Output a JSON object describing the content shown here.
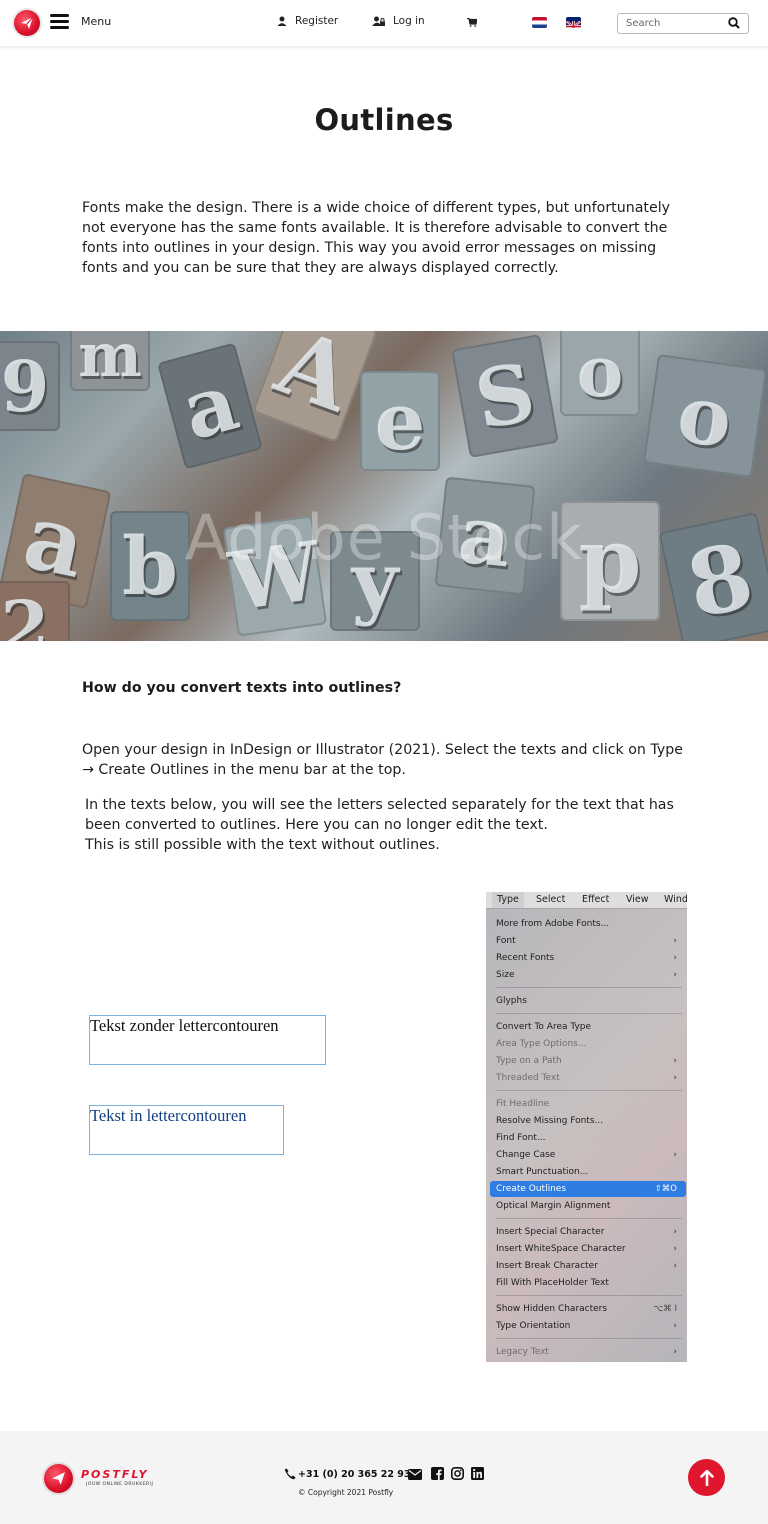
{
  "header": {
    "menu_label": "Menu",
    "register_label": "Register",
    "login_label": "Log in",
    "search_placeholder": "Search",
    "languages": [
      "nl",
      "en"
    ],
    "brand_color": "#e0162f"
  },
  "main": {
    "title": "Outlines",
    "intro": "Fonts make the design. There is a wide choice of different types, but unfortunately not everyone has the same fonts available. It is therefore advisable to convert the fonts into outlines in your design. This way you avoid error messages on missing fonts and you can be sure that they are always displayed correctly.",
    "hero_watermark": "Adobe Stock",
    "subheading": "How do you convert texts into outlines?",
    "para1": "Open your design in InDesign or Illustrator (2021). Select the texts and click on Type → Create Outlines in the menu bar at the top.",
    "para2": "In the texts below, you will see the letters selected separately for the text that has been converted to outlines. Here you can no longer edit the text.\nThis is still possible with the text without outlines.",
    "demo_without": "Tekst zonder lettercontouren",
    "demo_with": "Tekst in lettercontouren"
  },
  "menu_shot": {
    "menubar": [
      "Type",
      "Select",
      "Effect",
      "View",
      "Wind"
    ],
    "items": [
      {
        "label": "More from Adobe Fonts...",
        "arrow": false,
        "dim": false
      },
      {
        "label": "Font",
        "arrow": true,
        "dim": false
      },
      {
        "label": "Recent Fonts",
        "arrow": true,
        "dim": false
      },
      {
        "label": "Size",
        "arrow": true,
        "dim": false
      },
      {
        "label": "Glyphs",
        "arrow": false,
        "dim": false
      },
      {
        "label": "Convert To Area Type",
        "arrow": false,
        "dim": false
      },
      {
        "label": "Area Type Options...",
        "arrow": false,
        "dim": true
      },
      {
        "label": "Type on a Path",
        "arrow": true,
        "dim": true
      },
      {
        "label": "Threaded Text",
        "arrow": true,
        "dim": true
      },
      {
        "label": "Fit Headline",
        "arrow": false,
        "dim": true
      },
      {
        "label": "Resolve Missing Fonts...",
        "arrow": false,
        "dim": false
      },
      {
        "label": "Find Font...",
        "arrow": false,
        "dim": false
      },
      {
        "label": "Change Case",
        "arrow": true,
        "dim": false
      },
      {
        "label": "Smart Punctuation...",
        "arrow": false,
        "dim": false
      },
      {
        "label": "Create Outlines",
        "arrow": false,
        "dim": false,
        "shortcut": "⇧⌘O",
        "highlight": true
      },
      {
        "label": "Optical Margin Alignment",
        "arrow": false,
        "dim": false
      },
      {
        "label": "Insert Special Character",
        "arrow": true,
        "dim": false
      },
      {
        "label": "Insert WhiteSpace Character",
        "arrow": true,
        "dim": false
      },
      {
        "label": "Insert Break Character",
        "arrow": true,
        "dim": false
      },
      {
        "label": "Fill With PlaceHolder Text",
        "arrow": false,
        "dim": false
      },
      {
        "label": "Show Hidden Characters",
        "arrow": false,
        "dim": false,
        "shortcut": "⌥⌘ I"
      },
      {
        "label": "Type Orientation",
        "arrow": true,
        "dim": false
      },
      {
        "label": "Legacy Text",
        "arrow": true,
        "dim": true
      }
    ]
  },
  "footer": {
    "brand": "POSTFLY",
    "tagline": "JOUW ONLINE DRUKKERIJ",
    "phone": "+31 (0) 20 365 22 93",
    "copyright": "© Copyright 2021 Postfly"
  }
}
